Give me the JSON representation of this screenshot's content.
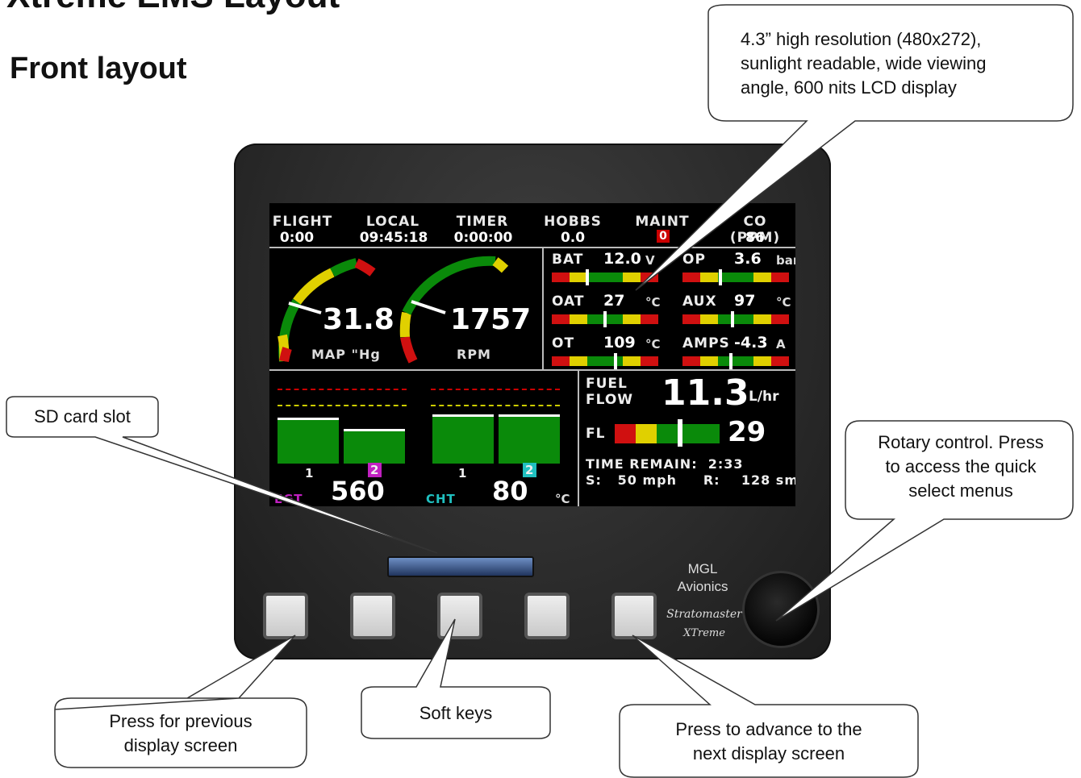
{
  "page": {
    "title": "Xtreme EMS Layout",
    "section": "Front layout"
  },
  "callouts": {
    "display": "4.3” high resolution (480x272), sunlight readable, wide viewing angle, 600 nits LCD display",
    "display_lines": [
      "4.3” high resolution (480x272),",
      "sunlight readable, wide viewing",
      "angle, 600 nits LCD display"
    ],
    "sd_card": "SD card slot",
    "rotary_lines": [
      "Rotary control. Press",
      "to access the quick",
      "select menus"
    ],
    "previous_lines": [
      "Press for previous",
      "display screen"
    ],
    "soft_keys": "Soft keys",
    "advance_lines": [
      "Press to advance to the",
      "next display screen"
    ]
  },
  "device": {
    "brand": "MGL",
    "brand_sub": "Avionics",
    "model_1": "Stratomaster",
    "model_2": "XTreme",
    "softkey_count": 5
  },
  "screen": {
    "header": [
      {
        "label": "FLIGHT",
        "value": "0:00"
      },
      {
        "label": "LOCAL",
        "value": "09:45:18"
      },
      {
        "label": "TIMER",
        "value": "0:00:00"
      },
      {
        "label": "HOBBS",
        "value": "0.0"
      },
      {
        "label": "MAINT",
        "value": "0"
      },
      {
        "label": "CO (PPM)",
        "value": "86"
      }
    ],
    "gauges": [
      {
        "value": "31.8",
        "label": "MAP \"Hg",
        "needle": 0.2
      },
      {
        "value": "1757",
        "label": "RPM",
        "needle": 0.22
      }
    ],
    "indicators": [
      {
        "label": "BAT",
        "value": "12.0",
        "unit": "V",
        "pos": 0.33
      },
      {
        "label": "OP",
        "value": "3.6",
        "unit": "bar",
        "pos": 0.35
      },
      {
        "label": "OAT",
        "value": "27",
        "unit": "°C",
        "pos": 0.5
      },
      {
        "label": "AUX",
        "value": "97",
        "unit": "°C",
        "pos": 0.47
      },
      {
        "label": "OT",
        "value": "109",
        "unit": "°C",
        "pos": 0.6
      },
      {
        "label": "AMPS",
        "value": "-4.3",
        "unit": "A",
        "pos": 0.45
      }
    ],
    "egt": {
      "label": "EGT",
      "value": "560",
      "cyl_1": "1",
      "cyl_2": "2"
    },
    "cht": {
      "label": "CHT",
      "value": "80",
      "unit": "°C",
      "cyl_1": "1",
      "cyl_2": "2"
    },
    "fuel": {
      "flow_label_1": "FUEL",
      "flow_label_2": "FLOW",
      "flow_value": "11.3",
      "flow_unit": "L/hr",
      "fl_label": "FL",
      "fl_value": "29",
      "time_remain": "TIME REMAIN:  2:33",
      "speed": "S:   50 mph     R:    128 sm"
    }
  }
}
